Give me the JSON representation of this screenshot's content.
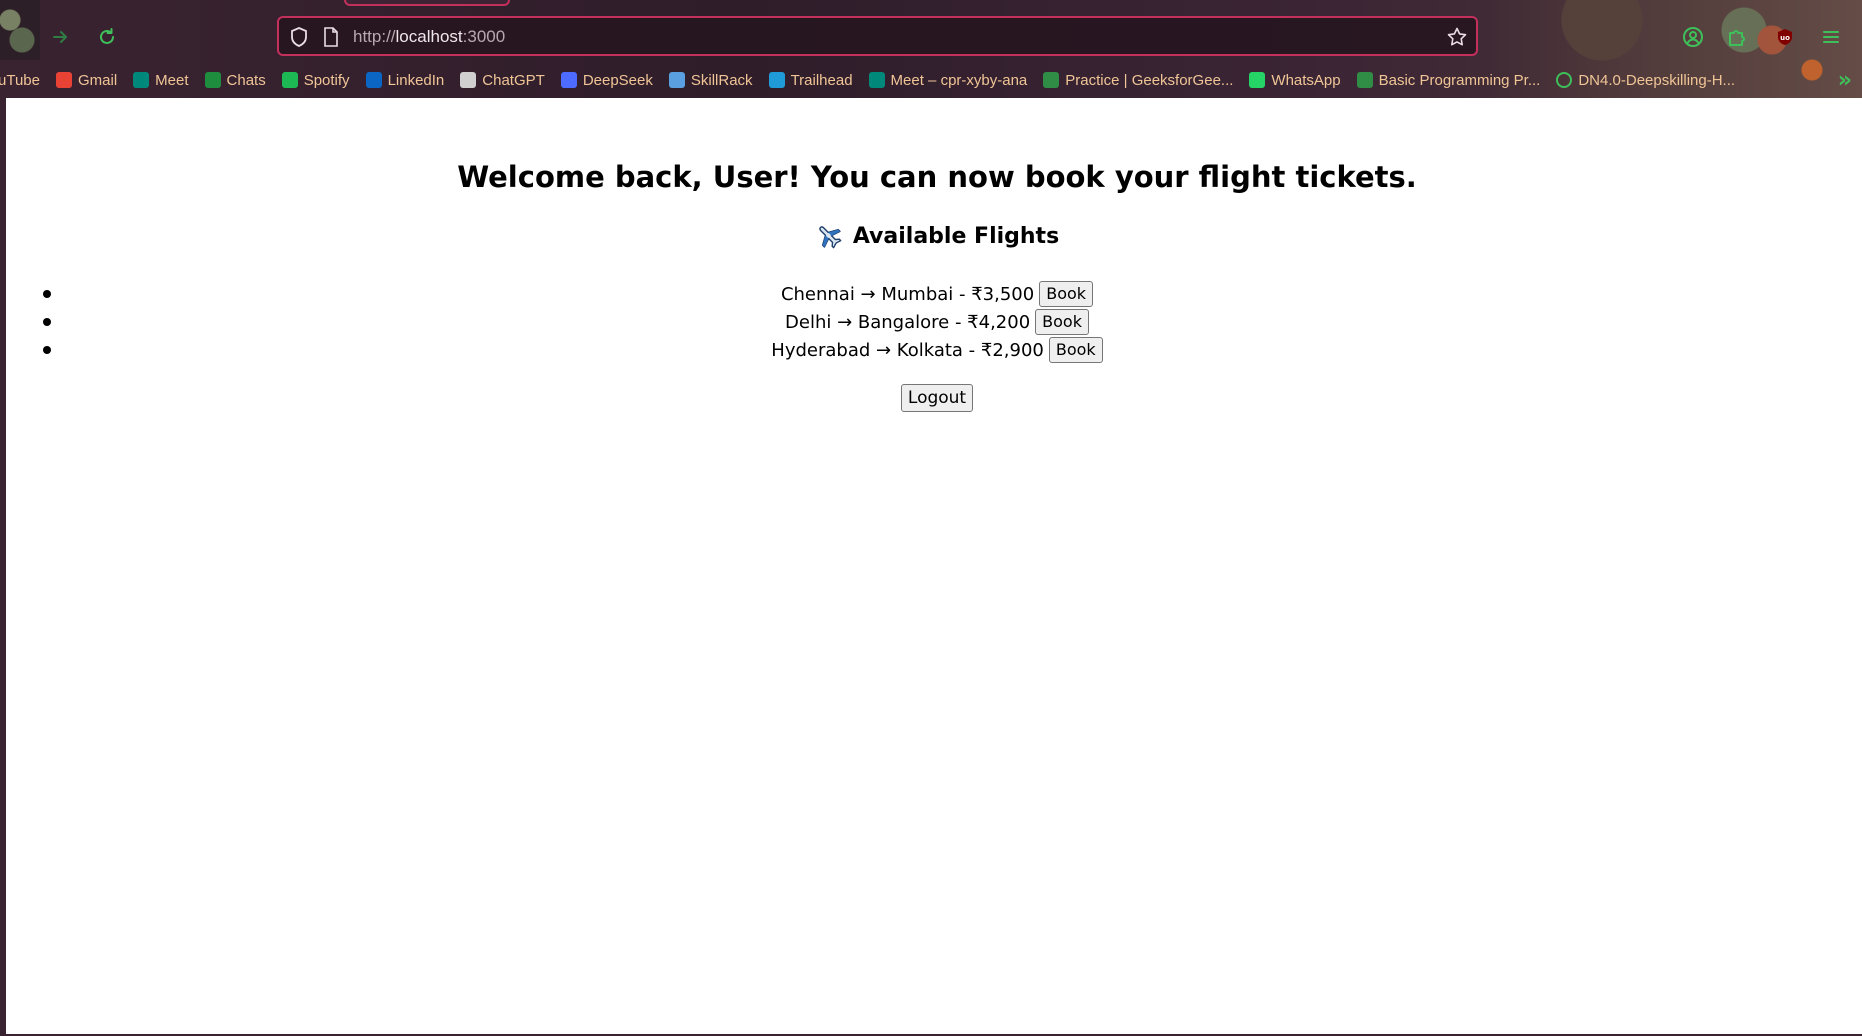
{
  "browser": {
    "url_scheme": "http://",
    "url_host": "localhost",
    "url_port": ":3000",
    "bookmarks": [
      {
        "label": "uTube",
        "icon": "youtube-icon",
        "color": "#ff0000"
      },
      {
        "label": "Gmail",
        "icon": "gmail-icon",
        "color": "#ea4335"
      },
      {
        "label": "Meet",
        "icon": "meet-icon",
        "color": "#00897b"
      },
      {
        "label": "Chats",
        "icon": "chat-icon",
        "color": "#1e8e3e"
      },
      {
        "label": "Spotify",
        "icon": "spotify-icon",
        "color": "#1db954"
      },
      {
        "label": "LinkedIn",
        "icon": "linkedin-icon",
        "color": "#0a66c2"
      },
      {
        "label": "ChatGPT",
        "icon": "chatgpt-icon",
        "color": "#cfcfcf"
      },
      {
        "label": "DeepSeek",
        "icon": "deepseek-icon",
        "color": "#4d6bfe"
      },
      {
        "label": "SkillRack",
        "icon": "skillrack-icon",
        "color": "#5aa0e0"
      },
      {
        "label": "Trailhead",
        "icon": "trailhead-icon",
        "color": "#1f9bd7"
      },
      {
        "label": "Meet – cpr-xyby-ana",
        "icon": "meet-icon",
        "color": "#00897b"
      },
      {
        "label": "Practice | GeeksforGee...",
        "icon": "geeksforgeeks-icon",
        "color": "#2f8d46"
      },
      {
        "label": "WhatsApp",
        "icon": "whatsapp-icon",
        "color": "#25d366"
      },
      {
        "label": "Basic Programming Pr...",
        "icon": "geeksforgeeks-icon",
        "color": "#2f8d46"
      },
      {
        "label": "DN4.0-Deepskilling-H...",
        "icon": "globe-icon",
        "color": "#3fbf5a"
      }
    ]
  },
  "page": {
    "welcome": "Welcome back, User! You can now book your flight tickets.",
    "flights_heading": "Available Flights",
    "book_label": "Book",
    "flights": [
      {
        "route": "Chennai → Mumbai - ₹3,500"
      },
      {
        "route": "Delhi → Bangalore - ₹4,200"
      },
      {
        "route": "Hyderabad → Kolkata - ₹2,900"
      }
    ],
    "logout_label": "Logout"
  }
}
